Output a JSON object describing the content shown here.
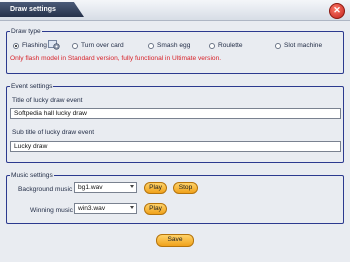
{
  "window": {
    "title": "Draw settings"
  },
  "draw_type": {
    "legend": "Draw type",
    "options": [
      "Flashing",
      "Turn over card",
      "Smash egg",
      "Roulette",
      "Slot machine"
    ],
    "selected": "Flashing",
    "note": "Only flash model in Standard version, fully functional in Ultimate version."
  },
  "event_settings": {
    "legend": "Event settings",
    "title_label": "Title of lucky draw event",
    "title_value": "Softpedia hall lucky draw",
    "subtitle_label": "Sub title of lucky draw event",
    "subtitle_value": "Lucky draw"
  },
  "music_settings": {
    "legend": "Music settings",
    "background_label": "Background music",
    "background_value": "bg1.wav",
    "winning_label": "Winning music",
    "winning_value": "win3.wav",
    "play_label": "Play",
    "stop_label": "Stop"
  },
  "save_label": "Save"
}
